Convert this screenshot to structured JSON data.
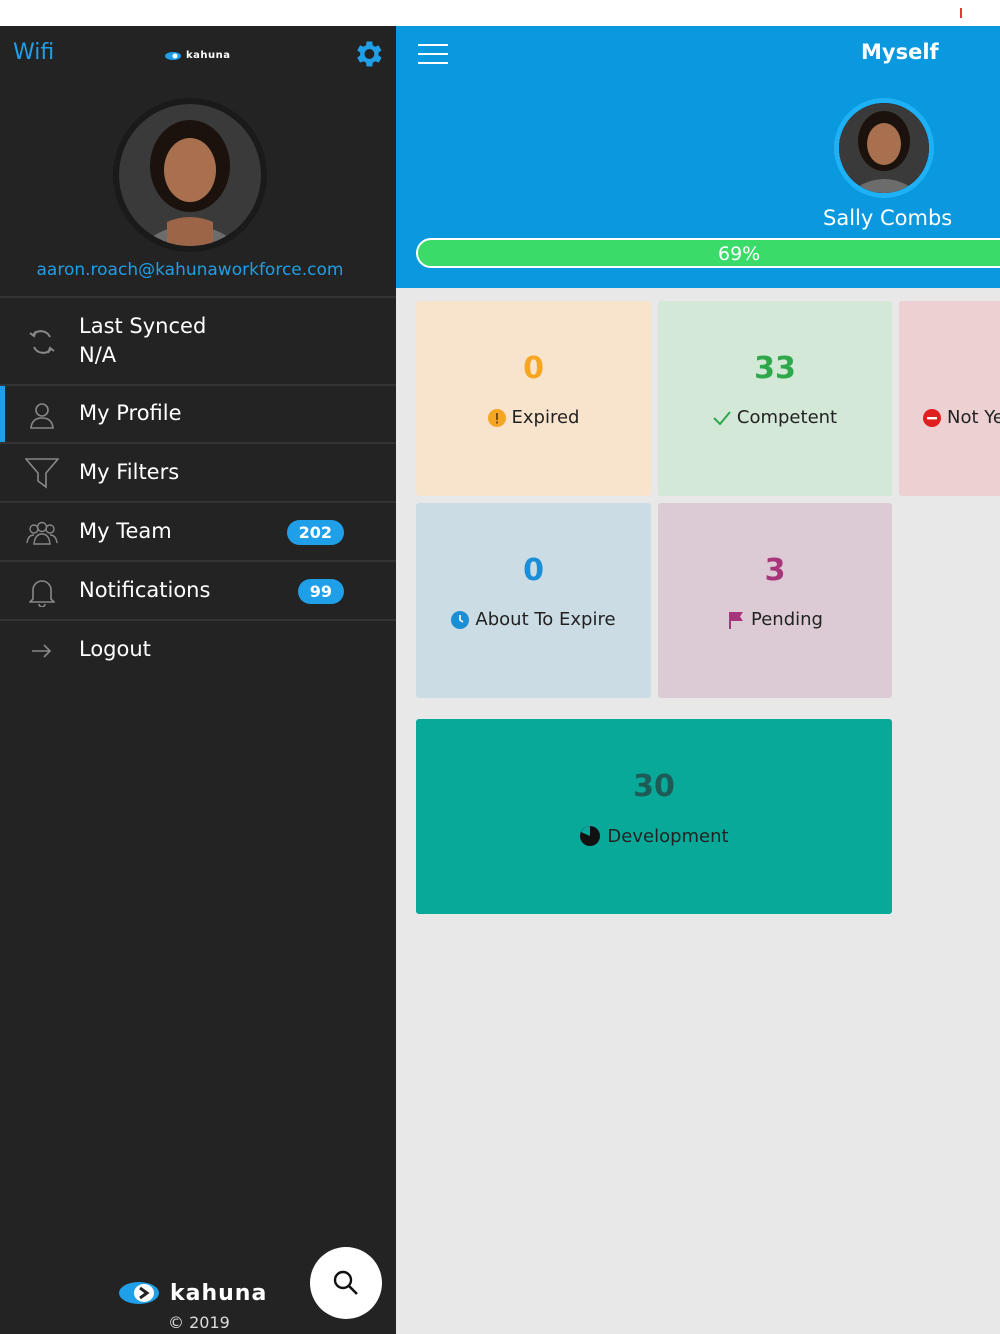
{
  "sidebar": {
    "wifi_label": "Wifi",
    "logo_small_text": "kahuna",
    "email": "aaron.roach@kahunaworkforce.com",
    "menu": [
      {
        "name": "last-synced",
        "label_line1": "Last Synced",
        "label_line2": "N/A",
        "icon": "sync-icon"
      },
      {
        "name": "my-profile",
        "label": "My Profile",
        "icon": "person-icon",
        "active": true
      },
      {
        "name": "my-filters",
        "label": "My Filters",
        "icon": "filter-icon"
      },
      {
        "name": "my-team",
        "label": "My Team",
        "icon": "team-icon",
        "badge": "202"
      },
      {
        "name": "notifications",
        "label": "Notifications",
        "icon": "bell-icon",
        "badge": "99"
      },
      {
        "name": "logout",
        "label": "Logout",
        "icon": "arrow-right-icon"
      }
    ],
    "brand_name": "kahuna",
    "copyright": "© 2019"
  },
  "main": {
    "title": "Myself",
    "user_name": "Sally Combs",
    "progress_label": "69%",
    "progress_value": 0.69,
    "cards": [
      {
        "name": "expired",
        "value": "0",
        "label": "Expired",
        "color": "#f5a623",
        "bg": "#f8e4cc",
        "icon": "warning-icon"
      },
      {
        "name": "competent",
        "value": "33",
        "label": "Competent",
        "color": "#2ea84a",
        "bg": "#d4e8d8",
        "icon": "check-icon"
      },
      {
        "name": "not-yet",
        "value": "",
        "label": "Not Ye",
        "color": "#e0201e",
        "bg": "#ecd0d2",
        "icon": "minus-circle-icon"
      },
      {
        "name": "about-to-expire",
        "value": "0",
        "label": "About To Expire",
        "color": "#1a8fd6",
        "bg": "#ccdce4",
        "icon": "clock-icon"
      },
      {
        "name": "pending",
        "value": "3",
        "label": "Pending",
        "color": "#a6357a",
        "bg": "#dccbd5",
        "icon": "flag-icon"
      },
      {
        "name": "development",
        "value": "30",
        "label": "Development",
        "color": "#1e5a56",
        "bg": "#09a99a",
        "icon": "pie-icon"
      }
    ]
  },
  "colors": {
    "accent": "#1f9fe8",
    "header_blue": "#0a98df",
    "progress_green": "#3bdb6a",
    "sidebar_bg": "#232323"
  }
}
